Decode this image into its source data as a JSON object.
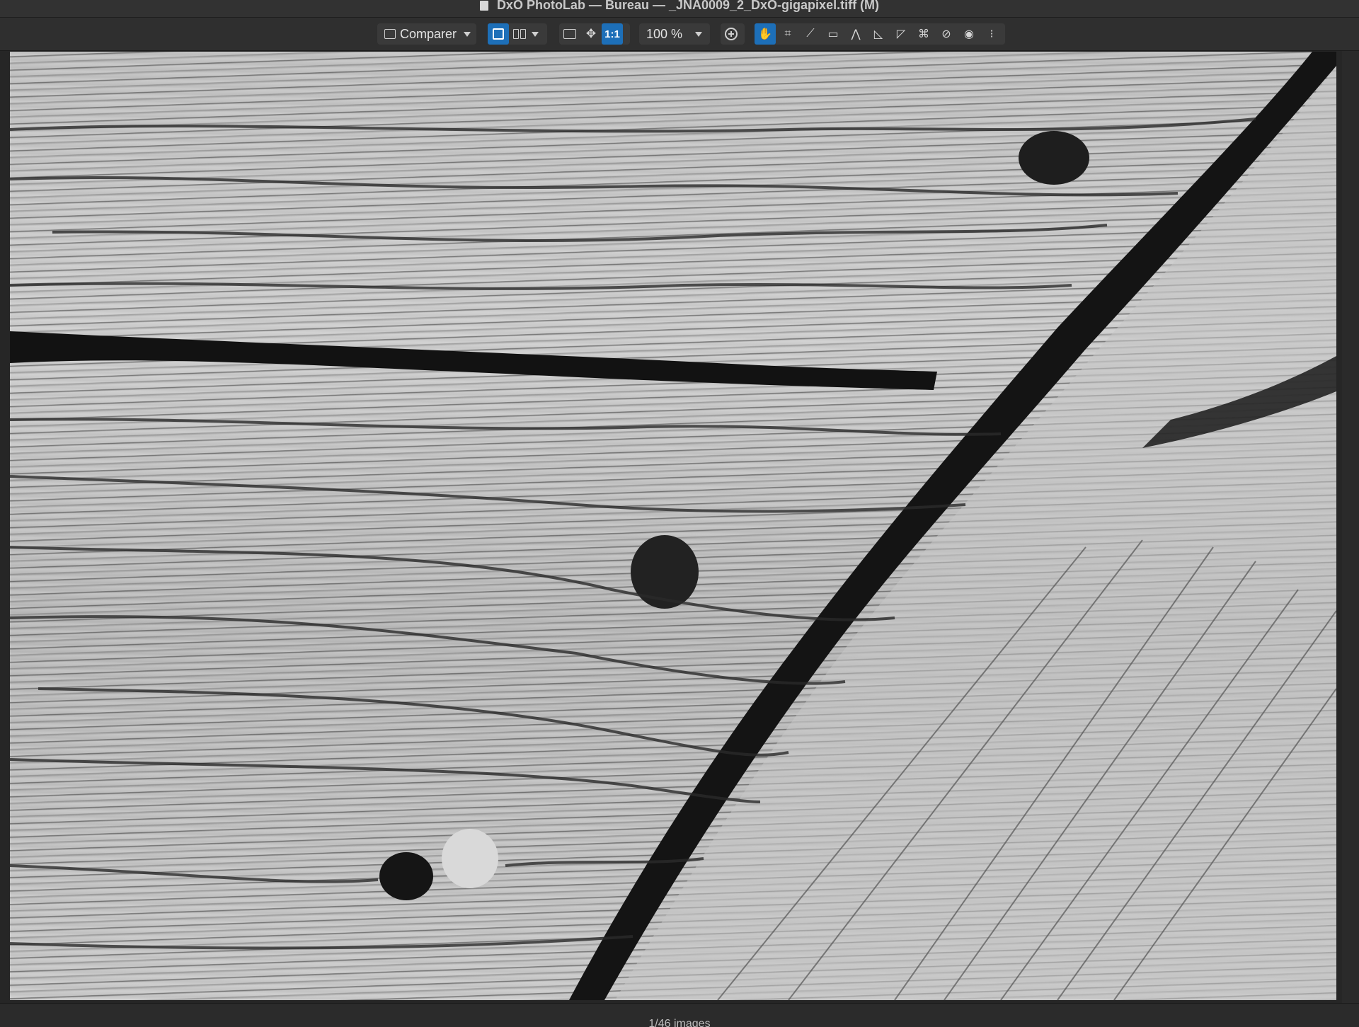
{
  "window": {
    "title": "DxO PhotoLab — Bureau — _JNA0009_2_DxO-gigapixel.tiff (M)"
  },
  "toolbar": {
    "compare_label": "Comparer",
    "one_to_one_label": "1:1",
    "zoom_value": "100 %",
    "active_color": "#1d6fb8",
    "tools": [
      {
        "name": "hand-tool-icon",
        "glyph": "✋",
        "active": true
      },
      {
        "name": "crop-icon",
        "glyph": "⌗"
      },
      {
        "name": "eyedropper-icon",
        "glyph": "⟋"
      },
      {
        "name": "horizon-icon",
        "glyph": "▭"
      },
      {
        "name": "perspective-icon",
        "glyph": "⋀"
      },
      {
        "name": "volume-deformation-icon",
        "glyph": "◺"
      },
      {
        "name": "local-adjustments-icon",
        "glyph": "◸"
      },
      {
        "name": "transform-icon",
        "glyph": "⌘"
      },
      {
        "name": "repair-icon",
        "glyph": "⊘"
      },
      {
        "name": "preview-eye-icon",
        "glyph": "◉"
      },
      {
        "name": "grid-guides-icon",
        "glyph": "⁝"
      }
    ]
  },
  "status": {
    "image_count": "1/46 images"
  }
}
